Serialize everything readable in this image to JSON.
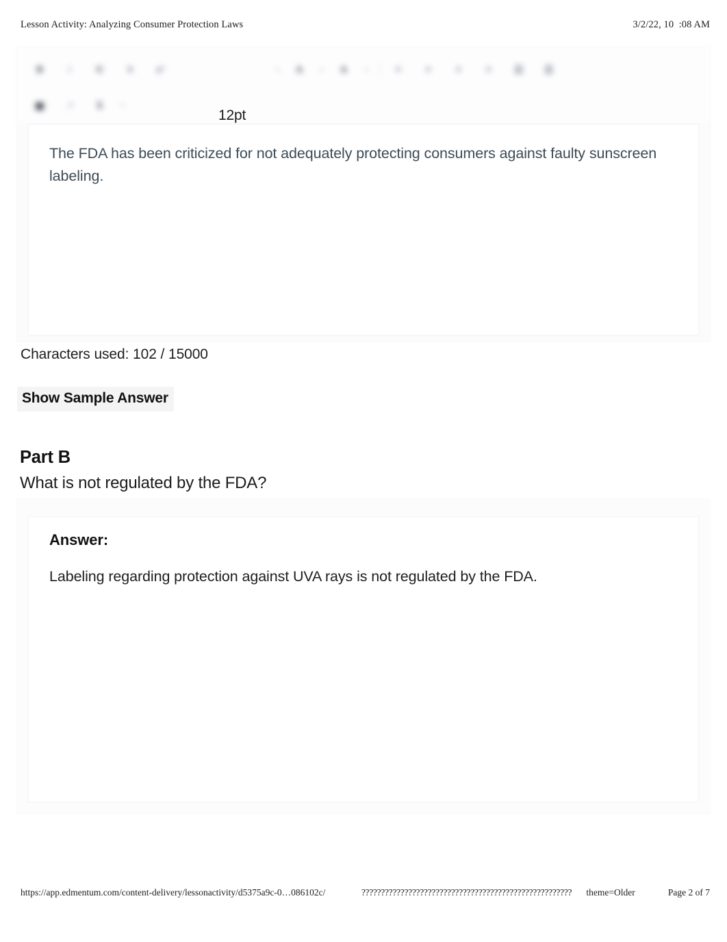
{
  "print_header": {
    "title": "Lesson Activity: Analyzing Consumer Protection Laws",
    "timestamp": "3/2/22, 10  :08 AM"
  },
  "editor": {
    "font_size_label": "12pt",
    "content": "The FDA has been criticized for not adequately protecting consumers against faulty sunscreen labeling.",
    "toolbar": {
      "row1": [
        {
          "name": "bold-icon",
          "glyph": "B",
          "weight": "strong"
        },
        {
          "name": "italic-icon",
          "glyph": "I",
          "weight": "faint"
        },
        {
          "name": "underline-icon",
          "glyph": "U",
          "weight": "strong"
        },
        {
          "name": "strikethrough-icon",
          "glyph": "S",
          "weight": "normal"
        },
        {
          "name": "superscript-icon",
          "glyph": "x²",
          "weight": "normal"
        }
      ],
      "row1_right": [
        {
          "name": "text-color-icon",
          "glyph": "A",
          "weight": "strong"
        },
        {
          "name": "highlight-color-icon",
          "glyph": "A",
          "weight": "strong"
        },
        {
          "name": "align-left-icon",
          "glyph": "≡",
          "weight": "normal"
        },
        {
          "name": "align-center-icon",
          "glyph": "≡",
          "weight": "normal"
        },
        {
          "name": "align-right-icon",
          "glyph": "≡",
          "weight": "normal"
        },
        {
          "name": "align-justify-icon",
          "glyph": "≡",
          "weight": "normal"
        },
        {
          "name": "bullet-list-icon",
          "glyph": "☰",
          "weight": "normal"
        },
        {
          "name": "numbered-list-icon",
          "glyph": "☰",
          "weight": "normal"
        }
      ],
      "row2": [
        {
          "name": "insert-image-icon",
          "glyph": "▣",
          "weight": "strong"
        },
        {
          "name": "insert-link-icon",
          "glyph": "↗",
          "weight": "faint"
        },
        {
          "name": "insert-equation-icon",
          "glyph": "Σ",
          "weight": "strong"
        }
      ]
    }
  },
  "character_counter": "Characters used: 102 / 15000",
  "sample_answer_button": "Show Sample Answer",
  "part_b": {
    "heading": "Part B",
    "question": "What is not regulated by the FDA?",
    "answer_label": "Answer:",
    "answer_text": "Labeling regarding protection against UVA rays is not regulated by the FDA."
  },
  "print_footer": {
    "url": "https://app.edmentum.com/content-delivery/lessonactivity/d5375a9c-0…086102c/",
    "unrenderable_text": "??????????????????????????????????????????????????????",
    "theme": "theme=Older",
    "page": "Page 2 of 7"
  }
}
